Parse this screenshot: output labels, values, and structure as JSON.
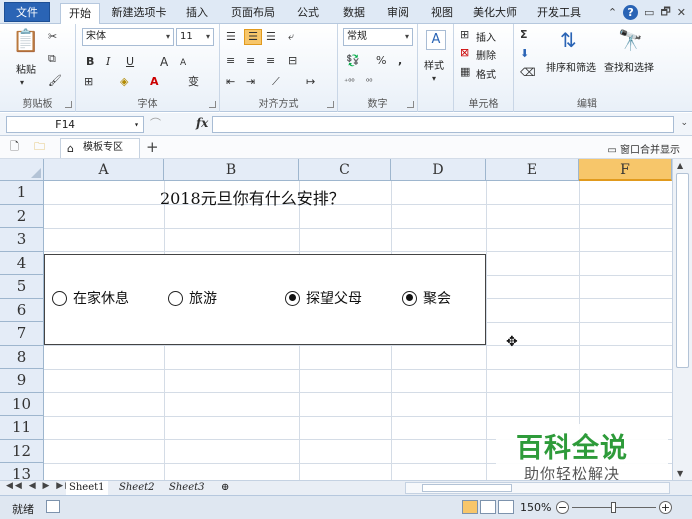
{
  "tabs": [
    "文件",
    "开始",
    "新建选项卡",
    "插入",
    "页面布局",
    "公式",
    "数据",
    "审阅",
    "视图",
    "美化大师",
    "开发工具"
  ],
  "active_tab": 1,
  "window_icons": {
    "help": "?",
    "minimize": "▭",
    "restore": "🗗",
    "close": "✕"
  },
  "clipboard": {
    "paste": "粘贴",
    "label": "剪贴板"
  },
  "font": {
    "name": "宋体",
    "size": "11",
    "bold": "B",
    "italic": "I",
    "underline": "U",
    "grow": "A",
    "shrink": "A",
    "phonetic": "变",
    "label": "字体"
  },
  "alignment": {
    "label": "对齐方式"
  },
  "number": {
    "format": "常规",
    "percent": "%",
    "comma": ",",
    "label": "数字"
  },
  "styles": {
    "label": "样式"
  },
  "cells": {
    "insert": "插入",
    "delete": "删除",
    "format": "格式",
    "label": "单元格"
  },
  "editing": {
    "sum": "Σ",
    "sort": "排序和筛选",
    "find": "查找和选择",
    "label": "编辑"
  },
  "formula_bar": {
    "name_box": "F14",
    "fx": "fx",
    "content": ""
  },
  "doc_tabs": {
    "template": "模板专区",
    "add": "+",
    "merge": "窗口合并显示"
  },
  "columns": [
    "A",
    "B",
    "C",
    "D",
    "E",
    "F"
  ],
  "active_column": 5,
  "rows": [
    "1",
    "2",
    "3",
    "4",
    "5",
    "6",
    "7",
    "8",
    "9",
    "10",
    "11",
    "12",
    "13"
  ],
  "sheet": {
    "title": "2018元旦你有什么安排？",
    "options": [
      {
        "label": "在家休息",
        "selected": false
      },
      {
        "label": "旅游",
        "selected": false
      },
      {
        "label": "探望父母",
        "selected": true
      },
      {
        "label": "聚会",
        "selected": true
      }
    ]
  },
  "sheet_tabs": [
    "Sheet1",
    "Sheet2",
    "Sheet3"
  ],
  "active_sheet": 0,
  "status": {
    "text": "就绪",
    "zoom": "150%"
  },
  "zoom_level": 0.5,
  "watermark": {
    "title": "百科全说",
    "subtitle": "助你轻松解决"
  }
}
